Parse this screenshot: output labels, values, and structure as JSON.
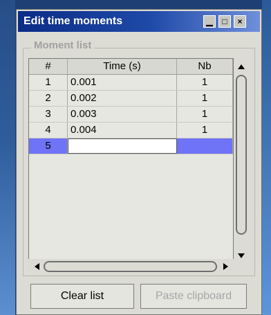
{
  "window": {
    "title": "Edit time moments"
  },
  "group": {
    "label": "Moment list"
  },
  "table": {
    "headers": [
      "#",
      "Time (s)",
      "Nb"
    ],
    "rows": [
      [
        "1",
        "0.001",
        "1"
      ],
      [
        "2",
        "0.002",
        "1"
      ],
      [
        "3",
        "0.003",
        "1"
      ],
      [
        "4",
        "0.004",
        "1"
      ],
      [
        "5",
        "",
        ""
      ]
    ],
    "selected_row_index": 5
  },
  "buttons": {
    "clear": "Clear list",
    "paste": "Paste clipboard"
  },
  "colors": {
    "title_bar": "#0b2c87",
    "selected_row": "#6f73f5"
  },
  "icons": {
    "minimize": "minimize-icon",
    "maximize": "maximize-icon",
    "close": "close-icon",
    "up": "arrow-up-icon",
    "down": "arrow-down-icon",
    "left": "arrow-left-icon",
    "right": "arrow-right-icon"
  }
}
